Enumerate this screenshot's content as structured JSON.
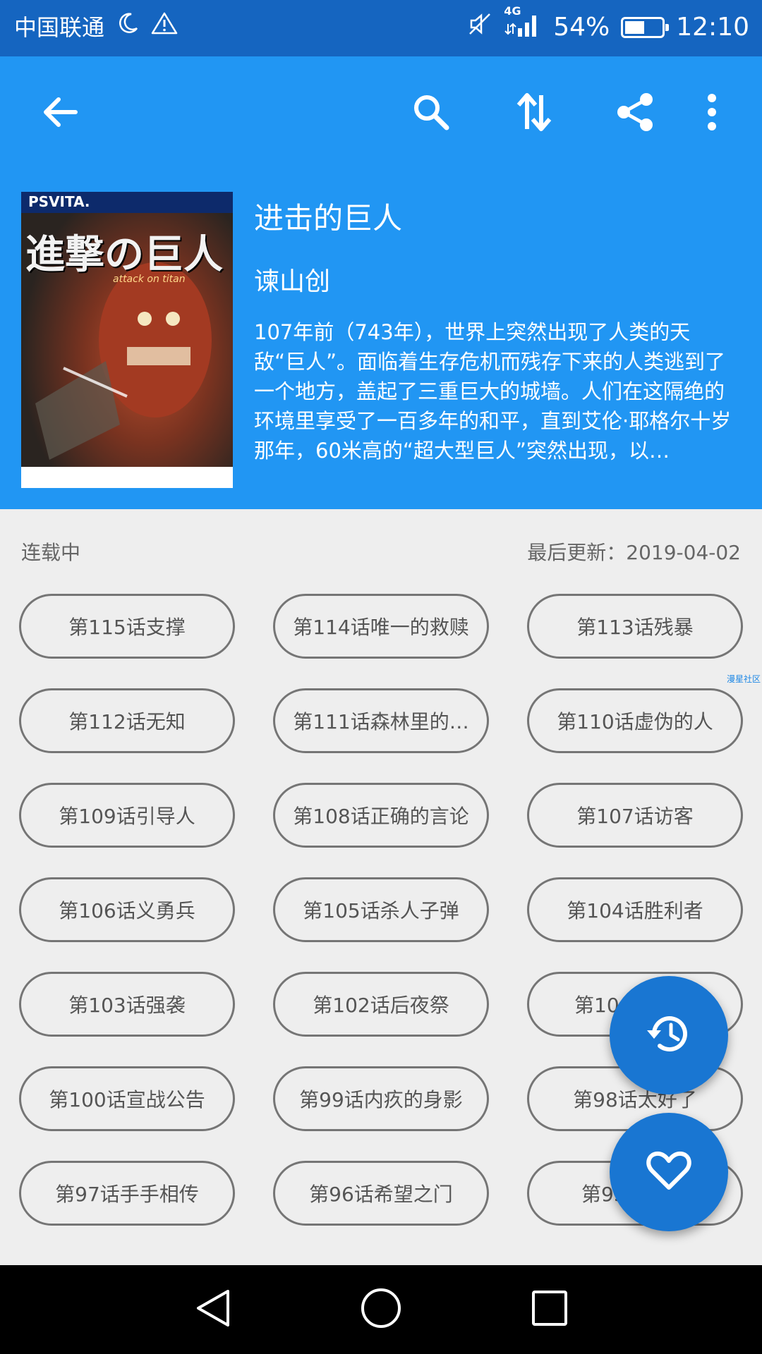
{
  "status_bar": {
    "carrier": "中国联通",
    "network": "4G",
    "battery": "54%",
    "battery_level": 0.54,
    "time": "12:10"
  },
  "toolbar": {
    "icons": [
      "back-arrow-icon",
      "search-icon",
      "sort-icon",
      "share-icon",
      "more-vert-icon"
    ]
  },
  "comic": {
    "cover_badge": "PSVITA.",
    "cover_title": "進撃の巨人",
    "cover_subtitle": "attack on titan",
    "title": "进击的巨人",
    "author": "谏山创",
    "description": "107年前（743年），世界上突然出现了人类的天敌“巨人”。面临着生存危机而残存下来的人类逃到了一个地方，盖起了三重巨大的城墙。人们在这隔绝的环境里享受了一百多年的和平，直到艾伦·耶格尔十岁那年，60米高的“超大型巨人”突然出现，以…"
  },
  "info": {
    "status": "连载中",
    "last_update": "最后更新：2019-04-02"
  },
  "watermark": "漫星社区",
  "chapters": [
    "第115话支撑",
    "第114话唯一的救赎",
    "第113话残暴",
    "第112话无知",
    "第111话森林里的…",
    "第110话虚伪的人",
    "第109话引导人",
    "第108话正确的言论",
    "第107话访客",
    "第106话义勇兵",
    "第105话杀人子弹",
    "第104话胜利者",
    "第103话强袭",
    "第102话后夜祭",
    "第10",
    "第100话宣战公告",
    "第99话内疚的身影",
    "第98话太好了",
    "第97话手手相传",
    "第96话希望之门",
    "第95"
  ],
  "fabs": [
    "history-icon",
    "heart-icon"
  ],
  "colors": {
    "primary": "#2196f3",
    "status_bar": "#1565c0",
    "fab": "#1976d2",
    "background": "#eeeeee"
  }
}
